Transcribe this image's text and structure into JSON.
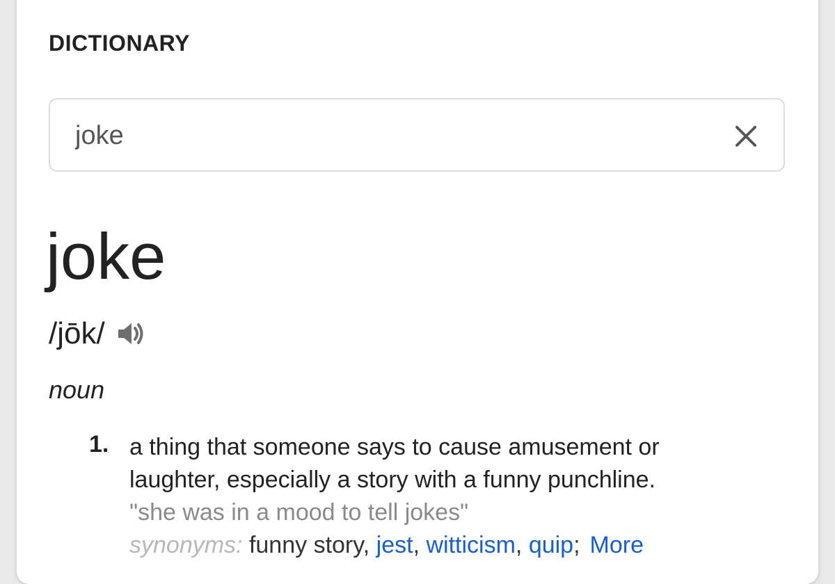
{
  "header": {
    "title": "DICTIONARY"
  },
  "search": {
    "value": "joke"
  },
  "entry": {
    "word": "joke",
    "pronunciation": "/jōk/",
    "part_of_speech": "noun",
    "definitions": [
      {
        "number": "1.",
        "text": "a thing that someone says to cause amusement or laughter, especially a story with a funny punchline.",
        "example": "\"she was in a mood to tell jokes\"",
        "synonyms_label": "synonyms:",
        "synonyms": [
          "funny story",
          "jest",
          "witticism",
          "quip"
        ],
        "more_label": "More"
      }
    ]
  },
  "icons": {
    "clear": "close-icon",
    "audio": "speaker-icon"
  },
  "colors": {
    "link": "#1a5fc9",
    "text": "#222222",
    "muted": "#8a8a8a"
  }
}
